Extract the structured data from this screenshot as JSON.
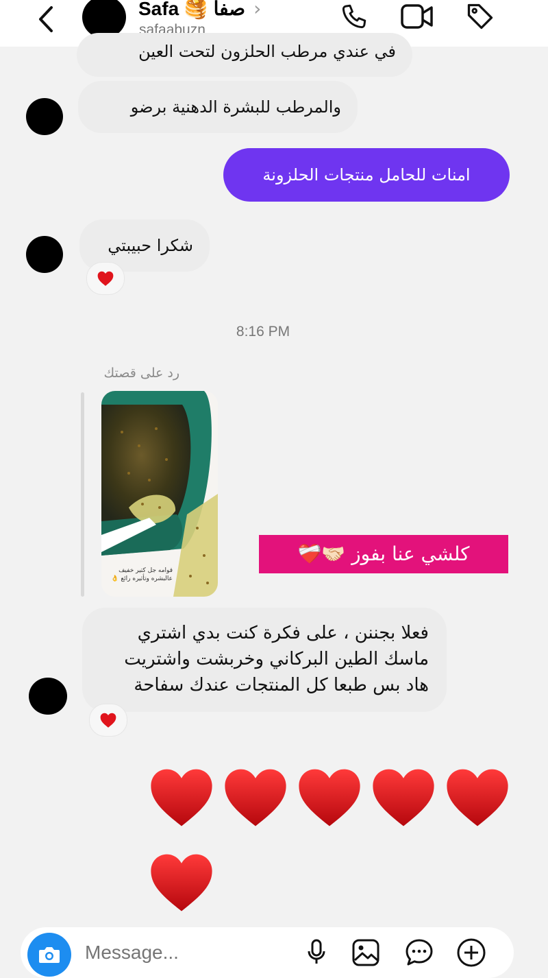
{
  "header": {
    "name": "Safa 🥞 صفا",
    "chevron": "›",
    "username": "safaabuzn",
    "icons": [
      "back-icon",
      "phone-icon",
      "video-icon",
      "tag-icon"
    ]
  },
  "messages": {
    "m1_partial": "في عندي مرطب الحلزون لتحت العين",
    "m2": "والمرطب للبشرة الدهنية برضو",
    "m3_out": "امنات للحامل منتجات الحلزونة",
    "m4": "شكرا حبيبتي",
    "m4_reaction": "❤️",
    "timestamp": "8:16 PM",
    "reply_label": "رد على قصتك",
    "story_caption": "قوامه جل كتير خفيف عالبشره وتأثيره رائع 👌",
    "story_reply": "كلشي عنا بفوز 🤝🏻❤️‍🩹",
    "m5": "فعلا بجننن ، على فكرة كنت بدي اشتري ماسك الطين البركاني وخربشت واشتريت هاد بس طبعا كل المنتجات عندك سفاحة",
    "m5_reaction": "❤️",
    "hearts_count": 6
  },
  "composer": {
    "placeholder": "Message...",
    "icons": [
      "camera-icon",
      "mic-icon",
      "gallery-icon",
      "sticker-icon",
      "add-icon"
    ]
  },
  "colors": {
    "outgoing": "#6f35f0",
    "incoming": "#ececec",
    "highlight": "#e3127b",
    "camera": "#1d8df0",
    "heart": "#e0141c"
  }
}
